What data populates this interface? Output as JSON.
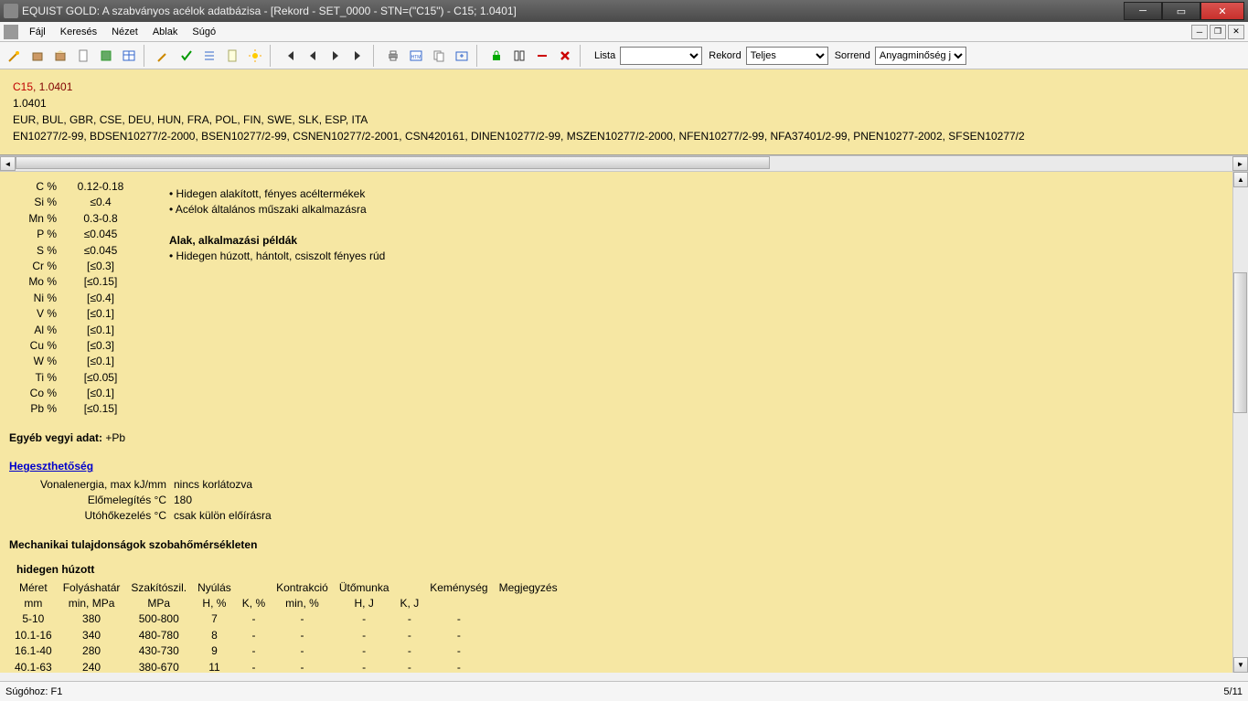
{
  "title": "EQUIST GOLD: A szabványos acélok adatbázisa - [Rekord - SET_0000 - STN=(\"C15\") - C15; 1.0401]",
  "menu": {
    "items": [
      "Fájl",
      "Keresés",
      "Nézet",
      "Ablak",
      "Súgó"
    ]
  },
  "toolbar": {
    "lista_label": "Lista",
    "lista_value": "",
    "rekord_label": "Rekord",
    "rekord_value": "Teljes",
    "sorrend_label": "Sorrend",
    "sorrend_value": "Anyagminőség je"
  },
  "header": {
    "l1a": "C15",
    "l1b": ", 1.0401",
    "l2": "1.0401",
    "l3": "EUR, BUL, GBR, CSE, DEU, HUN, FRA, POL, FIN, SWE, SLK, ESP, ITA",
    "l4": "EN10277/2-99, BDSEN10277/2-2000, BSEN10277/2-99, CSNEN10277/2-2001, CSN420161, DINEN10277/2-99, MSZEN10277/2-2000, NFEN10277/2-99, NFA37401/2-99, PNEN10277-2002, SFSEN10277/2"
  },
  "chem": [
    {
      "el": "C %",
      "val": "0.12-0.18"
    },
    {
      "el": "Si %",
      "val": "≤0.4"
    },
    {
      "el": "Mn %",
      "val": "0.3-0.8"
    },
    {
      "el": "P %",
      "val": "≤0.045"
    },
    {
      "el": "S %",
      "val": "≤0.045"
    },
    {
      "el": "Cr %",
      "val": "[≤0.3]"
    },
    {
      "el": "Mo %",
      "val": "[≤0.15]"
    },
    {
      "el": "Ni %",
      "val": "[≤0.4]"
    },
    {
      "el": "V %",
      "val": "[≤0.1]"
    },
    {
      "el": "Al %",
      "val": "[≤0.1]"
    },
    {
      "el": "Cu %",
      "val": "[≤0.3]"
    },
    {
      "el": "W %",
      "val": "[≤0.1]"
    },
    {
      "el": "Ti %",
      "val": "[≤0.05]"
    },
    {
      "el": "Co %",
      "val": "[≤0.1]"
    },
    {
      "el": "Pb %",
      "val": "[≤0.15]"
    }
  ],
  "notes": {
    "n1": "• Hidegen alakított, fényes acéltermékek",
    "n2": "• Acélok általános műszaki alkalmazásra",
    "h1": "Alak, alkalmazási példák",
    "n3": "• Hidegen húzott, hántolt, csiszolt fényes rúd"
  },
  "other": {
    "label": "Egyéb vegyi adat:",
    "value": " +Pb"
  },
  "weld": {
    "title": "Hegeszthetőség",
    "r1l": "Vonalenergia, max kJ/mm",
    "r1v": "nincs korlátozva",
    "r2l": "Előmelegítés °C",
    "r2v": "180",
    "r3l": "Utóhőkezelés °C",
    "r3v": "csak külön előírásra"
  },
  "mech": {
    "title": "Mechanikai tulajdonságok szobahőmérsékleten",
    "sub": "hidegen húzott",
    "head1": [
      "Méret",
      "Folyáshatár",
      "Szakítószil.",
      "Nyúlás",
      "",
      "Kontrakció",
      "Ütőmunka",
      "",
      "Keménység",
      "Megjegyzés"
    ],
    "head2": [
      "mm",
      "min, MPa",
      "MPa",
      "H, %",
      "K, %",
      "min, %",
      "H, J",
      "K, J",
      "",
      ""
    ],
    "rows": [
      [
        "5-10",
        "380",
        "500-800",
        "7",
        "-",
        "-",
        "-",
        "-",
        "-",
        ""
      ],
      [
        "10.1-16",
        "340",
        "480-780",
        "8",
        "-",
        "-",
        "-",
        "-",
        "-",
        ""
      ],
      [
        "16.1-40",
        "280",
        "430-730",
        "9",
        "-",
        "-",
        "-",
        "-",
        "-",
        ""
      ],
      [
        "40.1-63",
        "240",
        "380-670",
        "11",
        "-",
        "-",
        "-",
        "-",
        "-",
        ""
      ]
    ]
  },
  "status": {
    "left": "Súgóhoz: F1",
    "right": "5/11"
  }
}
